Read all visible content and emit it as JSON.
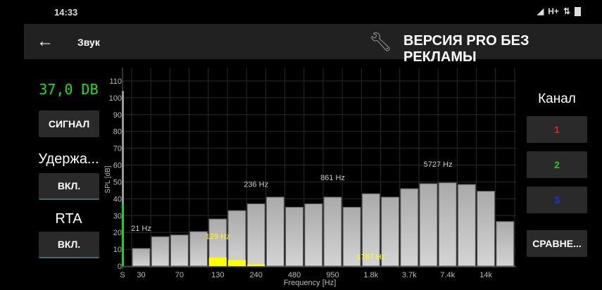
{
  "status": {
    "time": "14:33",
    "network": "H+"
  },
  "appbar": {
    "back_icon": "arrow-left-icon",
    "title": "Звук",
    "wrench_icon": "wrench-icon",
    "pro_label": "ВЕРСИЯ PRO БЕЗ РЕКЛАМЫ"
  },
  "left": {
    "level": "37,0 DB",
    "signal_button": "СИГНАЛ",
    "hold_label": "Удержа...",
    "hold_button": "ВКЛ.",
    "rta_label": "RTA",
    "rta_button": "ВКЛ."
  },
  "right": {
    "channel_label": "Канал",
    "channels": [
      {
        "label": "1",
        "color": "#e02020"
      },
      {
        "label": "2",
        "color": "#20d020"
      },
      {
        "label": "3",
        "color": "#2030e0"
      }
    ],
    "compare_button": "СРАВНЕ..."
  },
  "chart_data": {
    "type": "bar",
    "xlabel": "Frequency [Hz]",
    "ylabel": "SPL [dB]",
    "ylim": [
      0,
      110
    ],
    "yticks": [
      "0",
      "10",
      "20",
      "30",
      "40",
      "50",
      "60",
      "70",
      "80",
      "90",
      "100",
      "110"
    ],
    "meter_label": "S",
    "meter": {
      "level": 37,
      "peak": 104,
      "color": "#20d020"
    },
    "xticks": [
      {
        "bar": 0,
        "label": "30"
      },
      {
        "bar": 2,
        "label": "70"
      },
      {
        "bar": 4,
        "label": "130"
      },
      {
        "bar": 6,
        "label": "240"
      },
      {
        "bar": 8,
        "label": "480"
      },
      {
        "bar": 10,
        "label": "950"
      },
      {
        "bar": 12,
        "label": "1.8k"
      },
      {
        "bar": 14,
        "label": "3.7k"
      },
      {
        "bar": 16,
        "label": "7.4k"
      },
      {
        "bar": 18,
        "label": "14k"
      }
    ],
    "values": [
      10.5,
      17.5,
      18.5,
      20.5,
      28,
      33,
      37,
      41,
      35,
      37,
      41,
      35,
      43,
      41,
      46,
      49,
      49.5,
      48.5,
      44.5,
      26.5
    ],
    "hold_values": [
      0,
      0,
      0,
      0,
      5,
      3.5,
      1,
      0,
      0,
      0,
      0,
      0,
      0,
      0,
      0,
      0,
      0,
      0,
      0,
      0
    ],
    "peak_labels": [
      {
        "bar": 0,
        "label": "21 Hz",
        "value": 21
      },
      {
        "bar": 6,
        "label": "236 Hz",
        "value": 47
      },
      {
        "bar": 10,
        "label": "861 Hz",
        "value": 51
      },
      {
        "bar": 15.5,
        "label": "5727 Hz",
        "value": 59
      }
    ],
    "hold_labels": [
      {
        "bar": 4,
        "label": "129 Hz",
        "value": 16
      },
      {
        "bar": 12,
        "label": "1787 Hz",
        "value": 4
      }
    ],
    "bar_color": "#c8c8c8",
    "hold_color": "#ffff00"
  }
}
